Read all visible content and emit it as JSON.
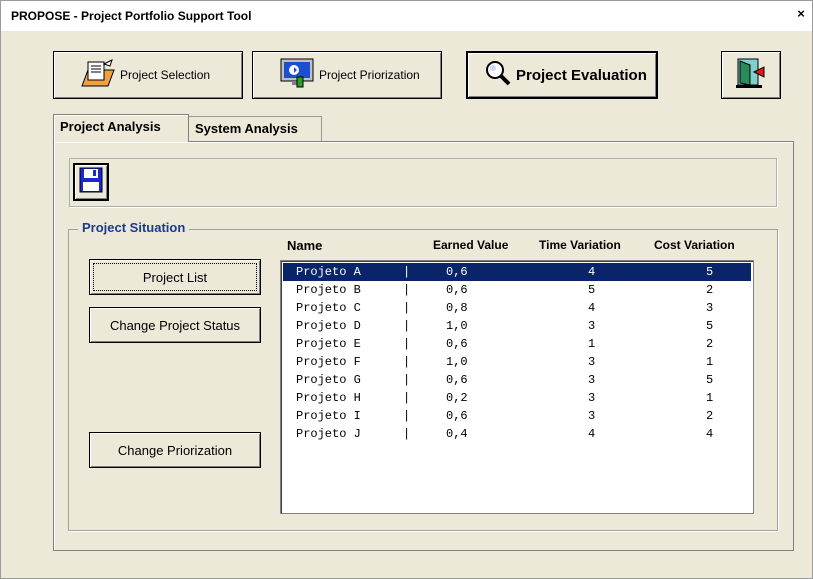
{
  "window": {
    "title": "PROPOSE - Project Portfolio Support Tool",
    "close_label": "×"
  },
  "nav": {
    "selection_label": "Project Selection",
    "priorization_label": "Project Priorization",
    "evaluation_label": "Project Evaluation"
  },
  "tabs": [
    {
      "label": "Project Analysis",
      "active": true
    },
    {
      "label": "System Analysis",
      "active": false
    }
  ],
  "situation": {
    "legend": "Project Situation",
    "buttons": {
      "list": "Project List",
      "status": "Change Project Status",
      "priorization": "Change Priorization"
    },
    "columns": [
      "Name",
      "Earned Value",
      "Time Variation",
      "Cost Variation"
    ],
    "rows": [
      {
        "name": "Projeto A",
        "sep": "|",
        "ev": "0,6",
        "tv": "4",
        "cv": "5",
        "selected": true
      },
      {
        "name": "Projeto B",
        "sep": "|",
        "ev": "0,6",
        "tv": "5",
        "cv": "2"
      },
      {
        "name": "Projeto C",
        "sep": "|",
        "ev": "0,8",
        "tv": "4",
        "cv": "3"
      },
      {
        "name": "Projeto D",
        "sep": "|",
        "ev": "1,0",
        "tv": "3",
        "cv": "5"
      },
      {
        "name": "Projeto E",
        "sep": "|",
        "ev": "0,6",
        "tv": "1",
        "cv": "2"
      },
      {
        "name": "Projeto F",
        "sep": "|",
        "ev": "1,0",
        "tv": "3",
        "cv": "1"
      },
      {
        "name": "Projeto G",
        "sep": "|",
        "ev": "0,6",
        "tv": "3",
        "cv": "5"
      },
      {
        "name": "Projeto H",
        "sep": "|",
        "ev": "0,2",
        "tv": "3",
        "cv": "1"
      },
      {
        "name": "Projeto I",
        "sep": "|",
        "ev": "0,6",
        "tv": "3",
        "cv": "2"
      },
      {
        "name": "Projeto J",
        "sep": "|",
        "ev": "0,4",
        "tv": "4",
        "cv": "4"
      }
    ]
  },
  "colors": {
    "selection": "#0a246a",
    "legend": "#1a3c8c",
    "face": "#ece9d8"
  },
  "icons": [
    "folder-select-icon",
    "monitor-priorization-icon",
    "magnifier-icon",
    "exit-door-icon",
    "floppy-save-icon"
  ]
}
